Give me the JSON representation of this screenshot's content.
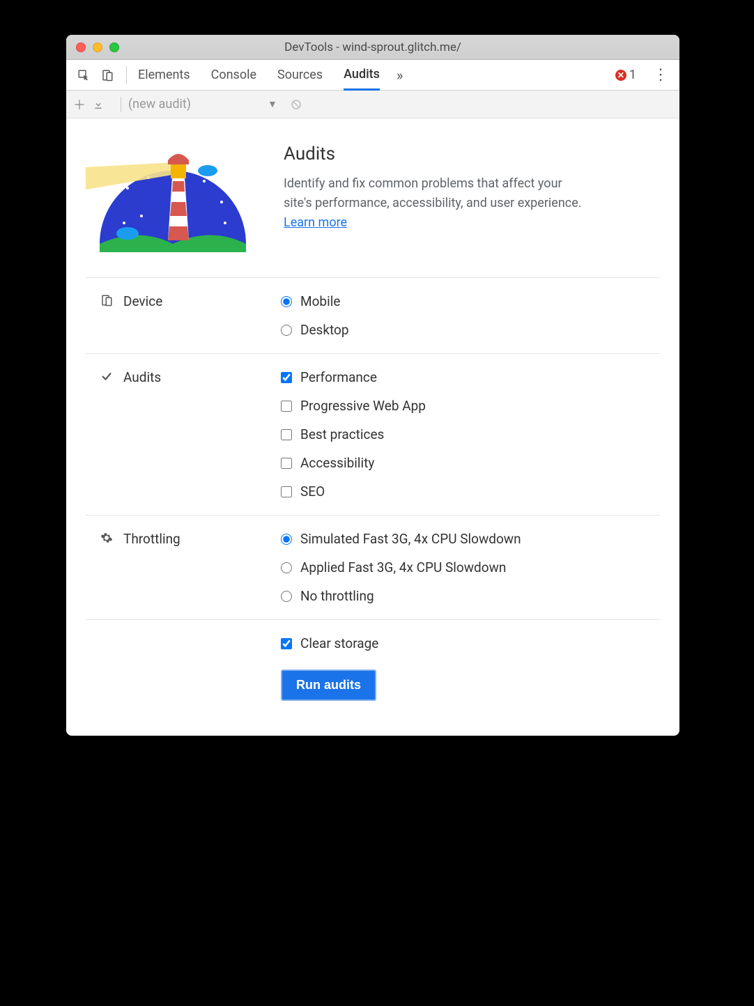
{
  "window": {
    "title": "DevTools - wind-sprout.glitch.me/"
  },
  "tabstrip": {
    "tabs": [
      "Elements",
      "Console",
      "Sources",
      "Audits"
    ],
    "active_index": 3,
    "error_count": "1"
  },
  "subbar": {
    "select_label": "(new audit)"
  },
  "intro": {
    "heading": "Audits",
    "body": "Identify and fix common problems that affect your site's performance, accessibility, and user experience. ",
    "link_text": "Learn more"
  },
  "device": {
    "label": "Device",
    "options": [
      {
        "label": "Mobile",
        "checked": true
      },
      {
        "label": "Desktop",
        "checked": false
      }
    ]
  },
  "audits": {
    "label": "Audits",
    "options": [
      {
        "label": "Performance",
        "checked": true
      },
      {
        "label": "Progressive Web App",
        "checked": false
      },
      {
        "label": "Best practices",
        "checked": false
      },
      {
        "label": "Accessibility",
        "checked": false
      },
      {
        "label": "SEO",
        "checked": false
      }
    ]
  },
  "throttling": {
    "label": "Throttling",
    "options": [
      {
        "label": "Simulated Fast 3G, 4x CPU Slowdown",
        "checked": true
      },
      {
        "label": "Applied Fast 3G, 4x CPU Slowdown",
        "checked": false
      },
      {
        "label": "No throttling",
        "checked": false
      }
    ]
  },
  "clear_storage": {
    "label": "Clear storage",
    "checked": true
  },
  "run_button": "Run audits"
}
